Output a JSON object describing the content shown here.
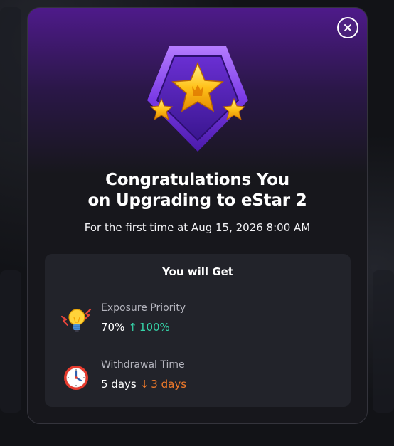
{
  "modal": {
    "title_line1": "Congratulations You",
    "title_line2": "on Upgrading to eStar 2",
    "subtitle": "For the first time at Aug 15, 2026 8:00 AM",
    "badge_icon": "estar-badge-icon",
    "close_icon": "close-icon"
  },
  "benefits": {
    "heading": "You will Get",
    "items": [
      {
        "icon": "lightbulb-icon",
        "label": "Exposure Priority",
        "old_value": "70%",
        "arrow": "↑",
        "new_value": "100%",
        "direction": "up"
      },
      {
        "icon": "alarm-clock-icon",
        "label": "Withdrawal Time",
        "old_value": "5 days",
        "arrow": "↓",
        "new_value": "3 days",
        "direction": "down"
      }
    ]
  },
  "colors": {
    "accent_purple": "#5a1f9c",
    "increase_green": "#35d3a8",
    "decrease_orange": "#f07a2a"
  }
}
